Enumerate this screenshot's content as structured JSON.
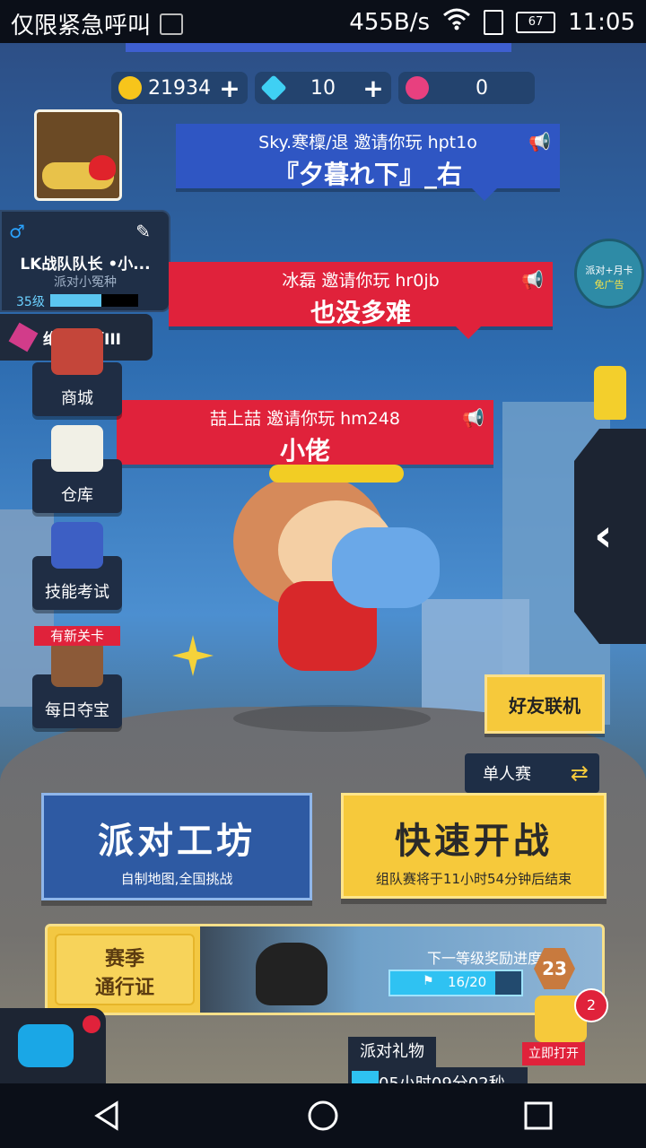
{
  "status_bar": {
    "left_text": "仅限紧急呼叫",
    "net_speed": "455B/s",
    "battery": "67",
    "time": "11:05"
  },
  "resources": {
    "coins": "21934",
    "diamonds": "10",
    "tokens": "0"
  },
  "profile": {
    "name": "LK战队队长 •小...",
    "subtitle": "派对小冤种",
    "level": "35级",
    "level_progress": 0.58,
    "rank": "绝世大师III"
  },
  "invites": [
    {
      "line1": "Sky.寒檁/退 邀请你玩 hpt1o",
      "line2": "『夕暮れ下』_右"
    },
    {
      "line1": "冰磊 邀请你玩 hr0jb",
      "line2": "也没多难"
    },
    {
      "line1": "喆上喆 邀请你玩 hm248",
      "line2": "小佬"
    }
  ],
  "menu": {
    "shop": "商城",
    "warehouse": "仓库",
    "skill_test": "技能考试",
    "new_level_badge": "有新关卡",
    "daily_treasure": "每日夺宝"
  },
  "monthly_card": {
    "line1": "派对+月卡",
    "line2": "免广告"
  },
  "buttons": {
    "friends": "好友联机",
    "mode": "单人赛",
    "party_title": "派对工坊",
    "party_sub": "自制地图,全国挑战",
    "fast_title": "快速开战",
    "fast_sub": "组队赛将于11小时54分钟后结束"
  },
  "season": {
    "line1": "赛季",
    "line2": "通行证",
    "reward_label": "下一等级奖励进度",
    "progress_text": "16/20",
    "progress": 0.8,
    "level": "23"
  },
  "gift": {
    "title": "派对礼物",
    "timer": "05小时09分02秒",
    "open_label": "立即打开",
    "badge": "2"
  },
  "colors": {
    "invite_blue": "#2f56c3",
    "invite_red": "#e0223b",
    "yellow": "#f6c93b",
    "dark_panel": "#1f2d44"
  }
}
